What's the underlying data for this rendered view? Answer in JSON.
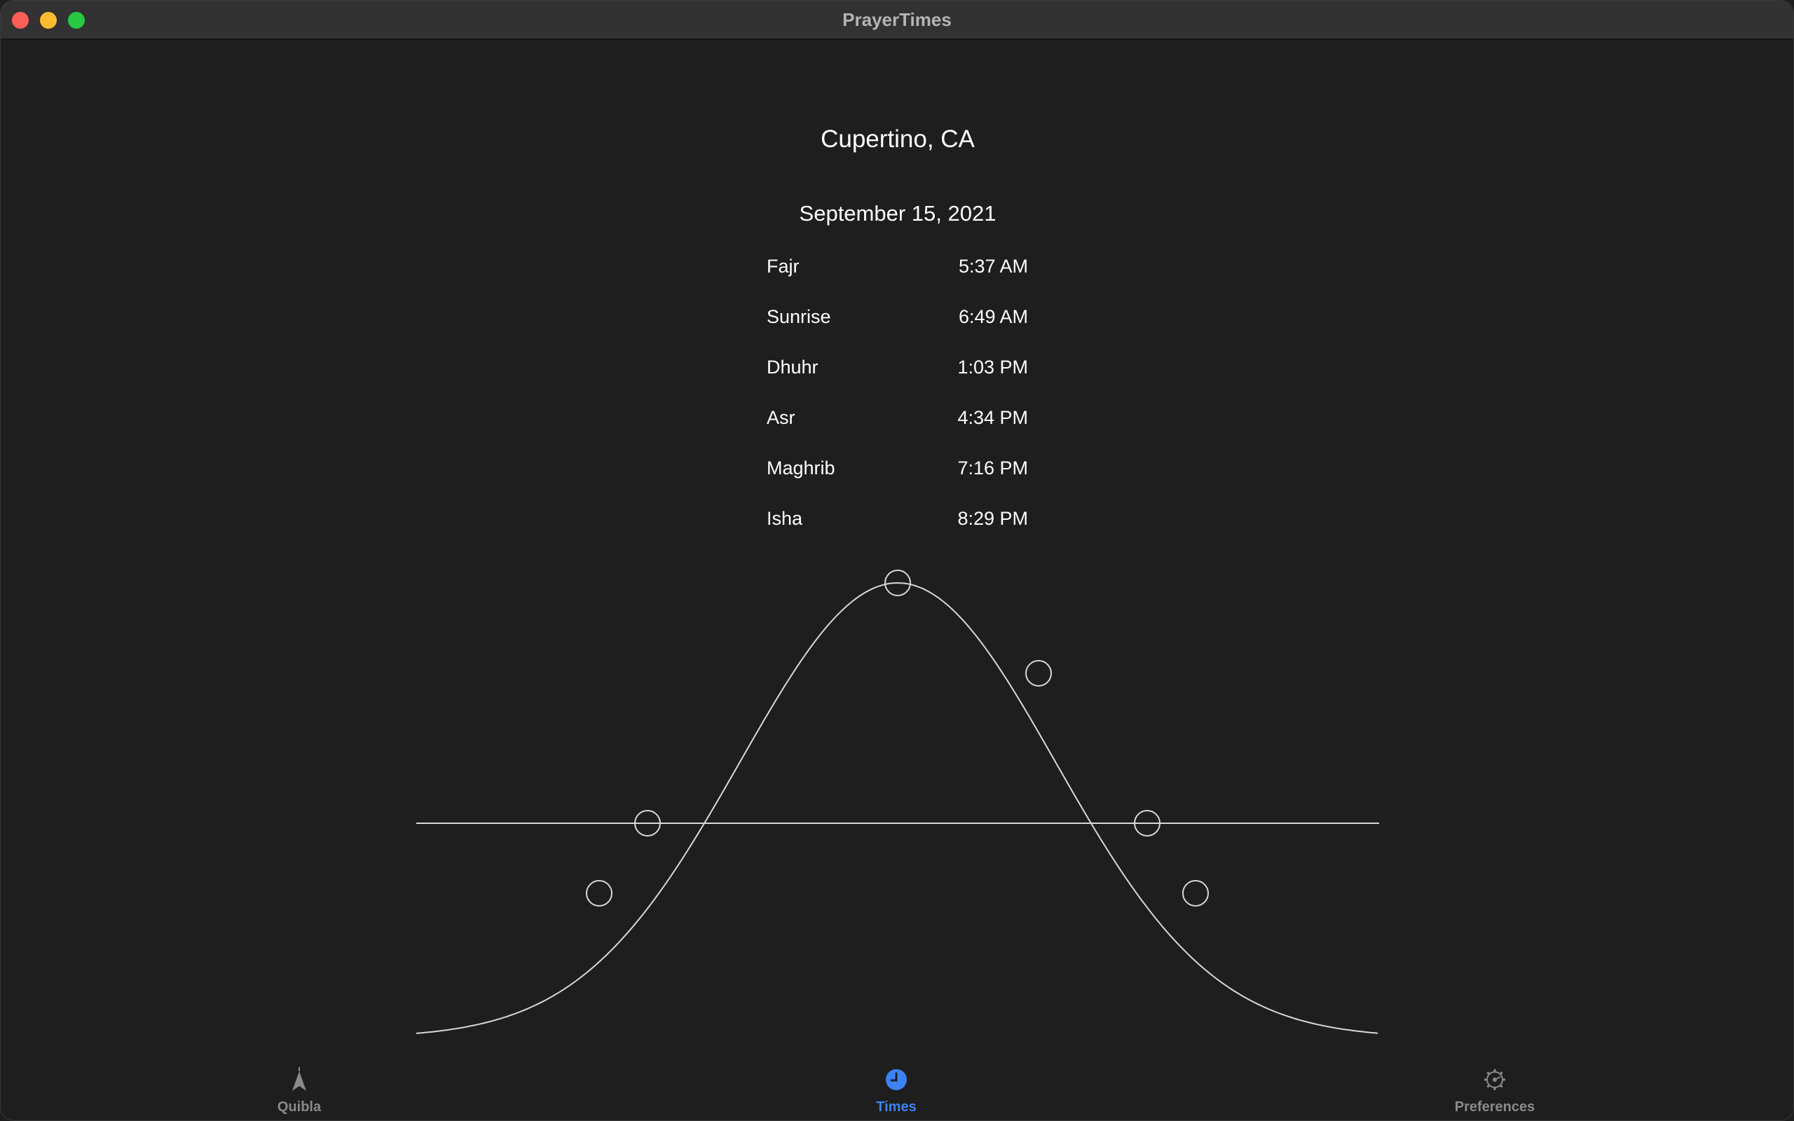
{
  "window": {
    "title": "PrayerTimes"
  },
  "location": "Cupertino, CA",
  "date": "September 15, 2021",
  "prayers": [
    {
      "name": "Fajr",
      "time": "5:37 AM"
    },
    {
      "name": "Sunrise",
      "time": "6:49 AM"
    },
    {
      "name": "Dhuhr",
      "time": "1:03 PM"
    },
    {
      "name": "Asr",
      "time": "4:34 PM"
    },
    {
      "name": "Maghrib",
      "time": "7:16 PM"
    },
    {
      "name": "Isha",
      "time": "8:29 PM"
    }
  ],
  "sun_curve": {
    "line_color": "#d8d8d8",
    "markers": [
      "Fajr",
      "Sunrise",
      "Dhuhr",
      "Asr",
      "Maghrib",
      "Isha"
    ]
  },
  "tabs": [
    {
      "label": "Quibla",
      "icon": "location-arrow-icon",
      "active": false
    },
    {
      "label": "Times",
      "icon": "clock-icon",
      "active": true
    },
    {
      "label": "Preferences",
      "icon": "gear-icon",
      "active": false
    }
  ],
  "colors": {
    "accent": "#3b82f6",
    "inactive": "#8a8a8a",
    "background": "#1e1e1e"
  }
}
